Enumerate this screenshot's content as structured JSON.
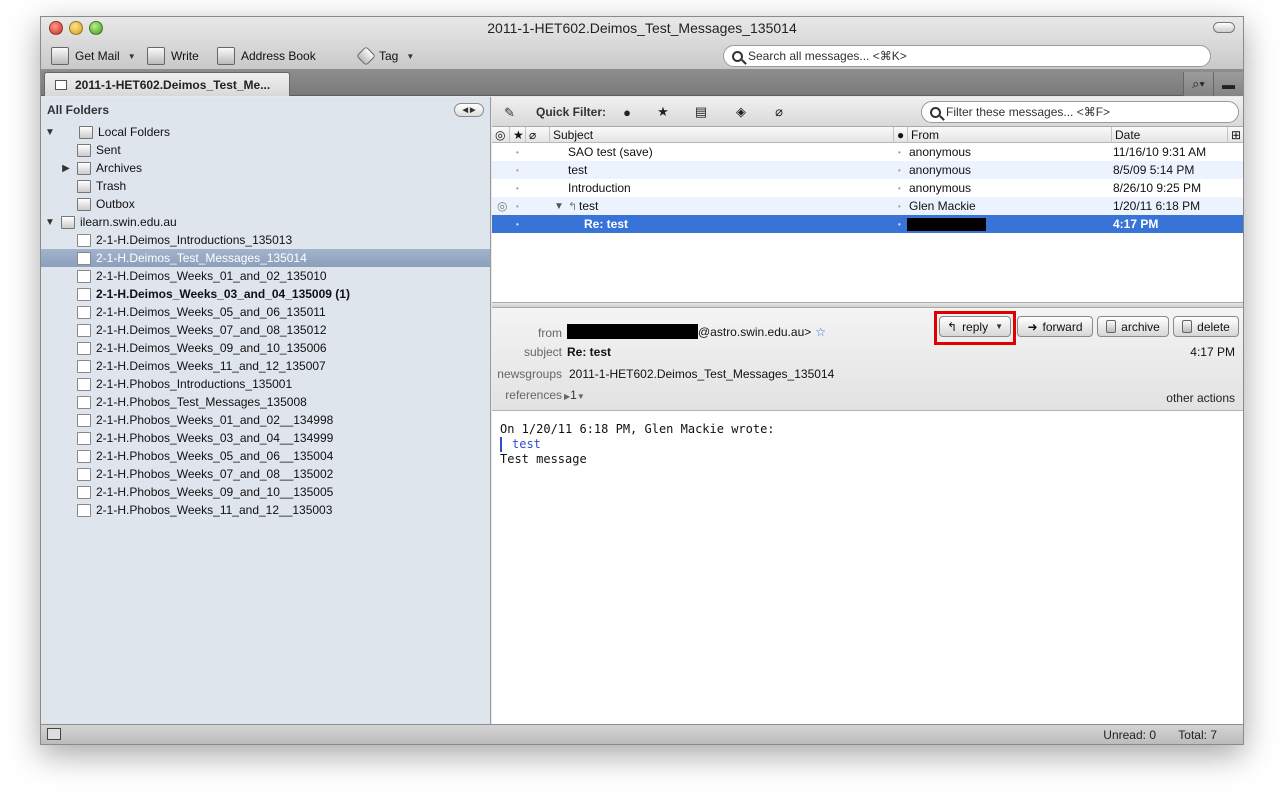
{
  "window": {
    "title": "2011-1-HET602.Deimos_Test_Messages_135014"
  },
  "toolbar": {
    "get_mail": "Get Mail",
    "write": "Write",
    "address_book": "Address Book",
    "tag": "Tag",
    "search_placeholder": "Search all messages... <⌘K>"
  },
  "tab": {
    "label": "2011-1-HET602.Deimos_Test_Me..."
  },
  "sidebar": {
    "header": "All Folders",
    "folders": [
      {
        "label": "Local Folders",
        "icon": "local-folders-icon"
      },
      {
        "label": "Sent",
        "icon": "sent-icon"
      },
      {
        "label": "Archives",
        "icon": "archives-icon"
      },
      {
        "label": "Trash",
        "icon": "trash-icon"
      },
      {
        "label": "Outbox",
        "icon": "outbox-icon"
      },
      {
        "label": "ilearn.swin.edu.au",
        "icon": "newsgroup-server-icon"
      },
      {
        "label": "2-1-H.Deimos_Introductions_135013"
      },
      {
        "label": "2-1-H.Deimos_Test_Messages_135014"
      },
      {
        "label": "2-1-H.Deimos_Weeks_01_and_02_135010"
      },
      {
        "label": "2-1-H.Deimos_Weeks_03_and_04_135009 (1)"
      },
      {
        "label": "2-1-H.Deimos_Weeks_05_and_06_135011"
      },
      {
        "label": "2-1-H.Deimos_Weeks_07_and_08_135012"
      },
      {
        "label": "2-1-H.Deimos_Weeks_09_and_10_135006"
      },
      {
        "label": "2-1-H.Deimos_Weeks_11_and_12_135007"
      },
      {
        "label": "2-1-H.Phobos_Introductions_135001"
      },
      {
        "label": "2-1-H.Phobos_Test_Messages_135008"
      },
      {
        "label": "2-1-H.Phobos_Weeks_01_and_02__134998"
      },
      {
        "label": "2-1-H.Phobos_Weeks_03_and_04__134999"
      },
      {
        "label": "2-1-H.Phobos_Weeks_05_and_06__135004"
      },
      {
        "label": "2-1-H.Phobos_Weeks_07_and_08__135002"
      },
      {
        "label": "2-1-H.Phobos_Weeks_09_and_10__135005"
      },
      {
        "label": "2-1-H.Phobos_Weeks_11_and_12__135003"
      }
    ]
  },
  "quick_filter": {
    "label": "Quick Filter:",
    "search_placeholder": "Filter these messages... <⌘F>"
  },
  "thread_list": {
    "columns": {
      "subject": "Subject",
      "from": "From",
      "date": "Date"
    },
    "rows": [
      {
        "subject": "SAO test (save)",
        "from": "anonymous",
        "date": "11/16/10 9:31 AM"
      },
      {
        "subject": "test",
        "from": "anonymous",
        "date": "8/5/09 5:14 PM"
      },
      {
        "subject": "Introduction",
        "from": "anonymous",
        "date": "8/26/10 9:25 PM"
      },
      {
        "subject": "test",
        "from": "Glen Mackie",
        "date": "1/20/11 6:18 PM"
      },
      {
        "subject": "Re: test",
        "from": "",
        "date": "4:17 PM"
      }
    ]
  },
  "message": {
    "from_label": "from",
    "from_value": "@astro.swin.edu.au>",
    "subject_label": "subject",
    "subject_value": "Re: test",
    "time": "4:17 PM",
    "newsgroups_label": "newsgroups",
    "newsgroups_value": "2011-1-HET602.Deimos_Test_Messages_135014",
    "references_label": "references",
    "references_value": "1",
    "other_actions": "other actions",
    "actions": {
      "reply": "reply",
      "forward": "forward",
      "archive": "archive",
      "delete": "delete"
    },
    "body": {
      "attribution": "On 1/20/11 6:18 PM, Glen Mackie wrote:",
      "quoted": "test",
      "text": "Test message"
    }
  },
  "status": {
    "unread": "Unread: 0",
    "total": "Total: 7"
  },
  "colors": {
    "selection": "#3874d8",
    "highlight_box": "#e00000",
    "quote": "#2f4ecf"
  }
}
